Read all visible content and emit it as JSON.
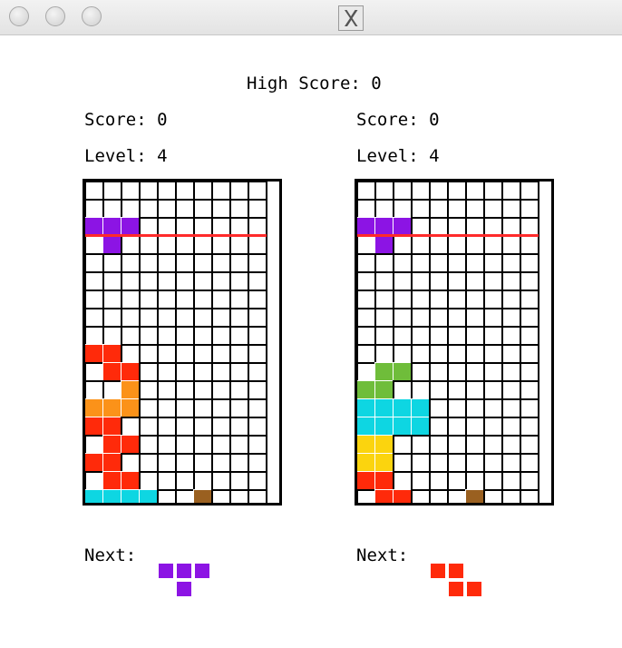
{
  "window": {
    "app_icon": "x11-icon"
  },
  "header": {
    "high_score_label": "High Score:",
    "high_score_value": "0"
  },
  "colors": {
    "P": "#8c14e4",
    "R": "#ff2a0a",
    "O": "#fb9219",
    "C": "#0ed6e2",
    "B": "#9a6020",
    "G": "#6fbd3a",
    "Y": "#fbd40e",
    "line": "#ff2a2a"
  },
  "players": [
    {
      "score_label": "Score:",
      "score_value": "0",
      "level_label": "Level:",
      "level_value": "4",
      "next_label": "Next:",
      "grid": [
        "..........",
        "..........",
        "PPP.......",
        ".P........",
        "..........",
        "..........",
        "..........",
        "..........",
        "..........",
        "RR........",
        ".RR.......",
        "..O.......",
        "OOO.......",
        "RR........",
        ".RR.......",
        "RR........",
        ".RR.......",
        "CCCC..B..."
      ],
      "next_piece": [
        "PPP",
        ".P."
      ]
    },
    {
      "score_label": "Score:",
      "score_value": "0",
      "level_label": "Level:",
      "level_value": "4",
      "next_label": "Next:",
      "grid": [
        "..........",
        "..........",
        "PPP.......",
        ".P........",
        "..........",
        "..........",
        "..........",
        "..........",
        "..........",
        "..........",
        ".GG.......",
        "GG........",
        "CCCC......",
        "CCCC......",
        "YY........",
        "YY........",
        "RR........",
        ".RR...B..."
      ],
      "next_piece": [
        "RR.",
        ".RR"
      ]
    }
  ]
}
